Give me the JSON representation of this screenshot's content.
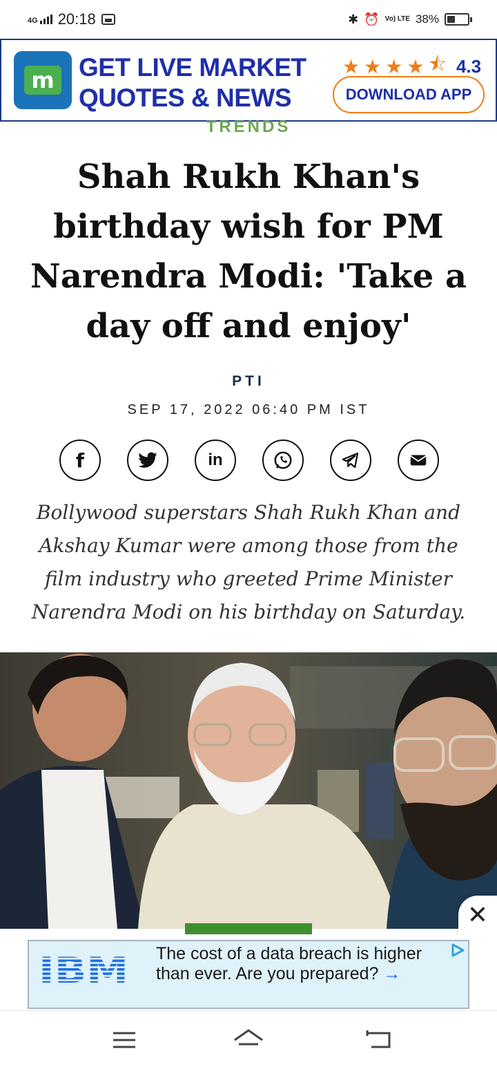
{
  "status_bar": {
    "network": "4G",
    "time": "20:18",
    "volte": "Vo) LTE",
    "battery_percent": "38%",
    "battery_level": 0.38,
    "icons": [
      "signal-icon",
      "sim-card-icon",
      "bluetooth-icon",
      "alarm-icon",
      "volte-icon",
      "battery-icon"
    ]
  },
  "top_ad": {
    "logo_letter": "m",
    "headline": "GET LIVE MARKET QUOTES & NEWS",
    "rating": "4.3",
    "stars": 4.5,
    "button_label": "DOWNLOAD APP",
    "colors": {
      "brand_blue": "#1e2fa8",
      "accent_orange": "#f07d16",
      "logo_green": "#4caf50"
    }
  },
  "article": {
    "category": "TRENDS",
    "title": "Shah Rukh Khan's birthday wish for PM Narendra Modi: 'Take a day off and enjoy'",
    "author": "PTI",
    "date": "SEP 17, 2022 06:40 PM IST",
    "share_icons": [
      "facebook-icon",
      "twitter-icon",
      "linkedin-icon",
      "whatsapp-icon",
      "telegram-icon",
      "email-icon"
    ],
    "summary": "Bollywood superstars Shah Rukh Khan and Akshay Kumar were among those from the film industry who greeted Prime Minister Narendra Modi on his birthday on Saturday."
  },
  "bottom_ad": {
    "brand": "IBM",
    "text": "The cost of a data breach is higher than ever. Are you prepared?",
    "arrow": "→",
    "close": "✕"
  },
  "nav_bar": {
    "icons": [
      "menu-icon",
      "home-icon",
      "back-icon"
    ]
  }
}
